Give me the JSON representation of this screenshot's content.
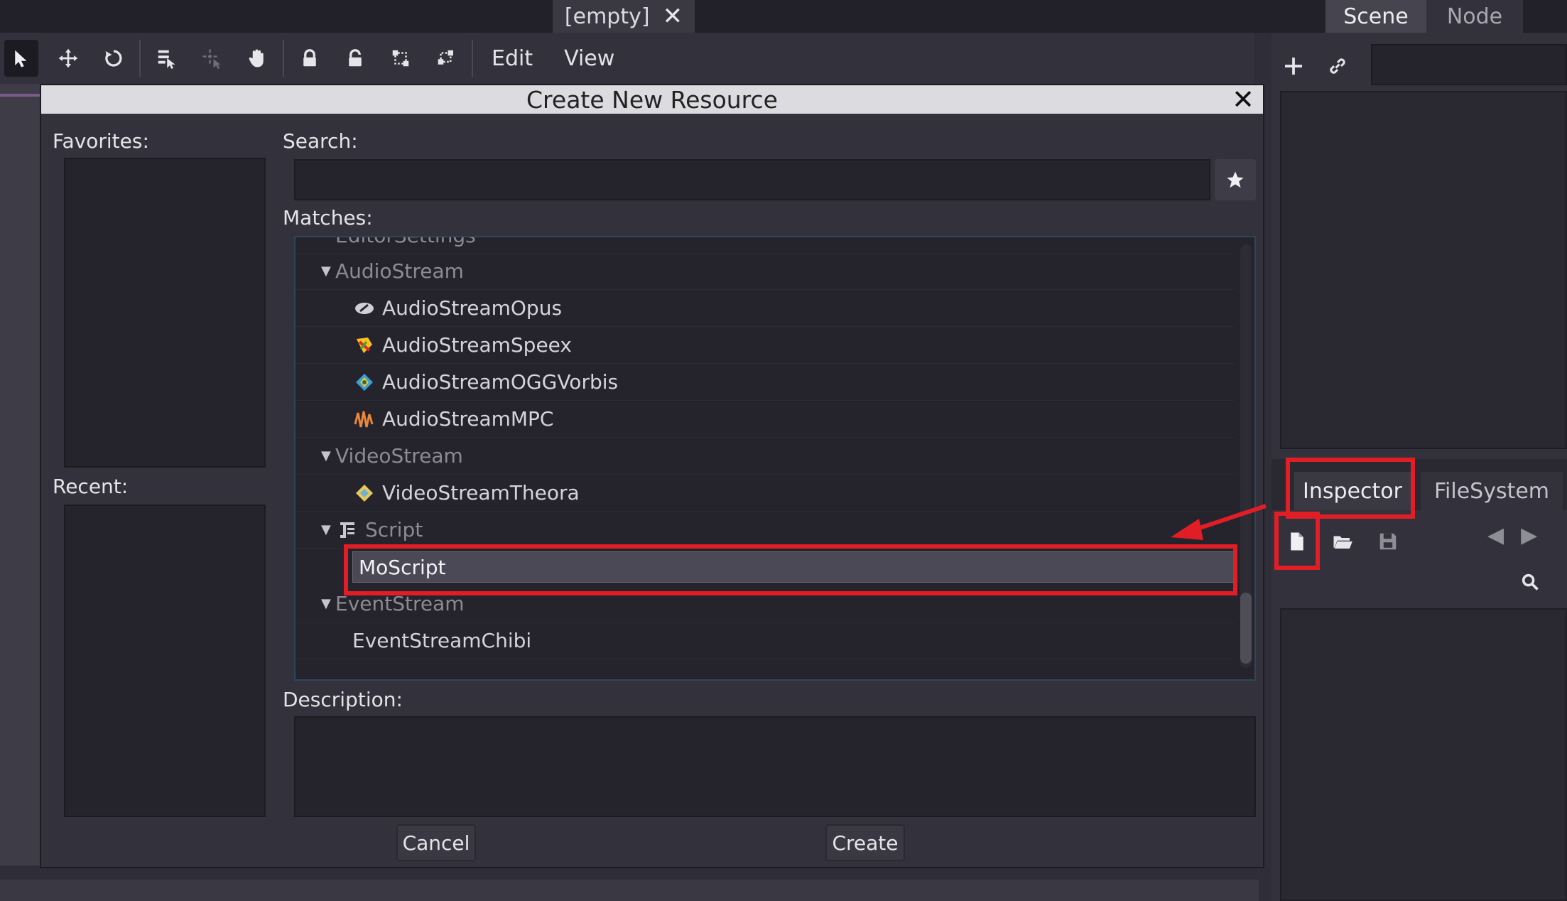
{
  "scene_tab": {
    "title": "[empty]",
    "close": "✕"
  },
  "toolbar": {
    "menus": [
      "Edit",
      "View"
    ]
  },
  "dock": {
    "top_tabs": [
      "Scene",
      "Node"
    ],
    "bottom_tabs": [
      "Inspector",
      "FileSystem"
    ]
  },
  "dialog": {
    "title": "Create New Resource",
    "close": "✕",
    "favorites_label": "Favorites:",
    "recent_label": "Recent:",
    "search_label": "Search:",
    "search_value": "",
    "matches_label": "Matches:",
    "description_label": "Description:",
    "cancel_label": "Cancel",
    "create_label": "Create",
    "tree": {
      "partial_top": "EditorSettings",
      "audio_group": "AudioStream",
      "audio_items": [
        "AudioStreamOpus",
        "AudioStreamSpeex",
        "AudioStreamOGGVorbis",
        "AudioStreamMPC"
      ],
      "video_group": "VideoStream",
      "video_items": [
        "VideoStreamTheora"
      ],
      "script_group": "Script",
      "script_items": [
        "MoScript"
      ],
      "event_group": "EventStream",
      "event_items": [
        "EventStreamChibi"
      ]
    }
  },
  "annotation": {
    "color": "#e11d25"
  }
}
